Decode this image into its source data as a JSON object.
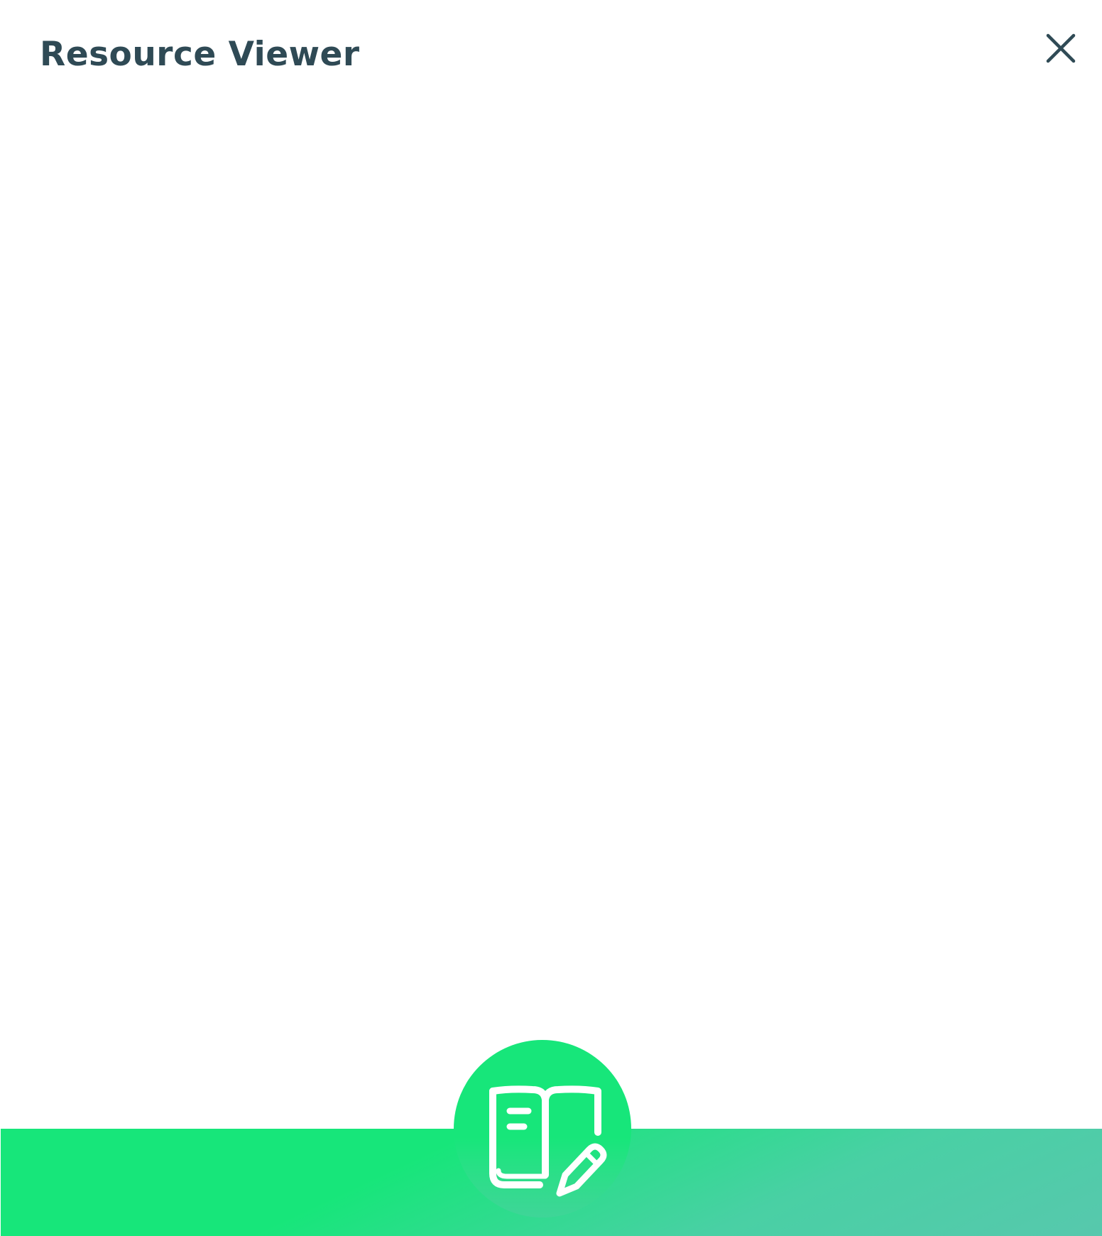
{
  "header": {
    "title": "Resource Viewer",
    "close_icon": "close-icon"
  },
  "footer": {
    "badge_icon": "book-edit-icon",
    "colors": {
      "accent_start": "#17e67a",
      "accent_end": "#57c8ad"
    }
  },
  "colors": {
    "title": "#2f4a55",
    "background": "#ffffff"
  }
}
